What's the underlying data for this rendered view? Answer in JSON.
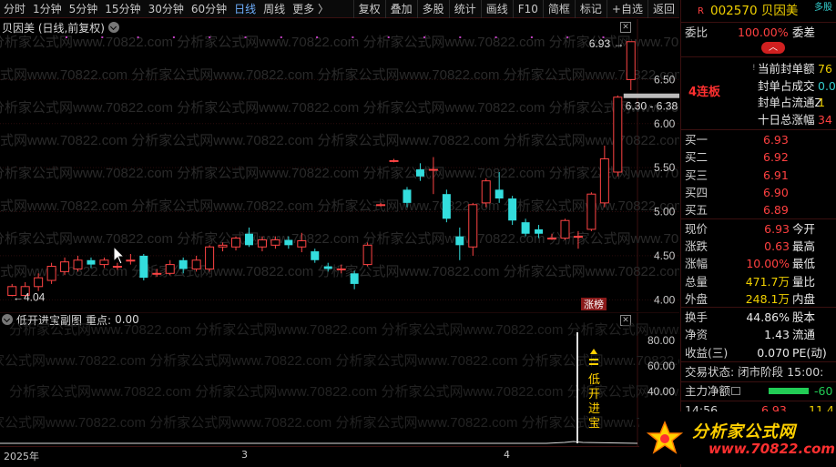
{
  "toolbar": {
    "periods": [
      "分时",
      "1分钟",
      "5分钟",
      "15分钟",
      "30分钟",
      "60分钟",
      "日线",
      "周线",
      "更多 〉"
    ],
    "buttons": [
      "复权",
      "叠加",
      "多股",
      "统计",
      "画线",
      "F10",
      "简框",
      "标记",
      "+自选",
      "返回"
    ]
  },
  "chart": {
    "title": "贝因美 (日线,前复权)",
    "y_ticks": [
      "6.50",
      "6.00",
      "5.50",
      "5.00",
      "4.50",
      "4.00"
    ],
    "high_label": "6.93",
    "low_label": "4.04",
    "price_box": "6.30 - 6.38",
    "zhangting_tag": "涨榜",
    "watermark": "分析家公式网www.70822.com"
  },
  "chart_data": {
    "type": "candlestick",
    "ylim": [
      3.9,
      7.0
    ],
    "candles": [
      {
        "o": 4.05,
        "c": 4.15,
        "h": 4.18,
        "l": 4.04
      },
      {
        "o": 4.05,
        "c": 4.15,
        "h": 4.2,
        "l": 4.03
      },
      {
        "o": 4.15,
        "c": 4.25,
        "h": 4.3,
        "l": 4.1
      },
      {
        "o": 4.22,
        "c": 4.38,
        "h": 4.42,
        "l": 4.18
      },
      {
        "o": 4.32,
        "c": 4.43,
        "h": 4.48,
        "l": 4.28
      },
      {
        "o": 4.35,
        "c": 4.45,
        "h": 4.5,
        "l": 4.32
      },
      {
        "o": 4.45,
        "c": 4.4,
        "h": 4.48,
        "l": 4.36
      },
      {
        "o": 4.4,
        "c": 4.45,
        "h": 4.48,
        "l": 4.36
      },
      {
        "o": 4.38,
        "c": 4.38,
        "h": 4.42,
        "l": 4.34
      },
      {
        "o": 4.45,
        "c": 4.45,
        "h": 4.52,
        "l": 4.4
      },
      {
        "o": 4.5,
        "c": 4.25,
        "h": 4.52,
        "l": 4.22
      },
      {
        "o": 4.3,
        "c": 4.3,
        "h": 4.35,
        "l": 4.26
      },
      {
        "o": 4.3,
        "c": 4.4,
        "h": 4.45,
        "l": 4.28
      },
      {
        "o": 4.45,
        "c": 4.35,
        "h": 4.48,
        "l": 4.3
      },
      {
        "o": 4.35,
        "c": 4.45,
        "h": 4.5,
        "l": 4.32
      },
      {
        "o": 4.35,
        "c": 4.6,
        "h": 4.62,
        "l": 4.32
      },
      {
        "o": 4.6,
        "c": 4.62,
        "h": 4.65,
        "l": 4.55
      },
      {
        "o": 4.6,
        "c": 4.7,
        "h": 4.72,
        "l": 4.56
      },
      {
        "o": 4.75,
        "c": 4.62,
        "h": 4.82,
        "l": 4.6
      },
      {
        "o": 4.6,
        "c": 4.68,
        "h": 4.72,
        "l": 4.55
      },
      {
        "o": 4.62,
        "c": 4.68,
        "h": 4.72,
        "l": 4.58
      },
      {
        "o": 4.68,
        "c": 4.62,
        "h": 4.72,
        "l": 4.58
      },
      {
        "o": 4.6,
        "c": 4.67,
        "h": 4.76,
        "l": 4.54
      },
      {
        "o": 4.55,
        "c": 4.45,
        "h": 4.58,
        "l": 4.42
      },
      {
        "o": 4.38,
        "c": 4.35,
        "h": 4.42,
        "l": 4.32
      },
      {
        "o": 4.35,
        "c": 4.35,
        "h": 4.4,
        "l": 4.3
      },
      {
        "o": 4.3,
        "c": 4.18,
        "h": 4.33,
        "l": 4.12
      },
      {
        "o": 4.4,
        "c": 4.62,
        "h": 4.65,
        "l": 4.38
      },
      {
        "o": 5.08,
        "c": 5.08,
        "h": 5.1,
        "l": 5.06
      },
      {
        "o": 5.58,
        "c": 5.58,
        "h": 5.6,
        "l": 5.56
      },
      {
        "o": 5.25,
        "c": 5.1,
        "h": 5.28,
        "l": 5.05
      },
      {
        "o": 5.48,
        "c": 5.4,
        "h": 5.55,
        "l": 5.35
      },
      {
        "o": 5.48,
        "c": 5.48,
        "h": 5.62,
        "l": 5.2
      },
      {
        "o": 5.2,
        "c": 4.92,
        "h": 5.25,
        "l": 4.88
      },
      {
        "o": 4.72,
        "c": 4.62,
        "h": 4.82,
        "l": 4.45
      },
      {
        "o": 4.6,
        "c": 5.08,
        "h": 5.1,
        "l": 4.5
      },
      {
        "o": 5.1,
        "c": 5.35,
        "h": 5.38,
        "l": 5.05
      },
      {
        "o": 5.25,
        "c": 5.15,
        "h": 5.45,
        "l": 5.1
      },
      {
        "o": 5.15,
        "c": 4.9,
        "h": 5.18,
        "l": 4.85
      },
      {
        "o": 4.88,
        "c": 4.75,
        "h": 4.92,
        "l": 4.72
      },
      {
        "o": 4.8,
        "c": 4.75,
        "h": 4.85,
        "l": 4.7
      },
      {
        "o": 4.7,
        "c": 4.7,
        "h": 4.75,
        "l": 4.68
      },
      {
        "o": 4.7,
        "c": 4.9,
        "h": 4.92,
        "l": 4.68
      },
      {
        "o": 4.72,
        "c": 4.72,
        "h": 4.78,
        "l": 4.58
      },
      {
        "o": 4.8,
        "c": 5.2,
        "h": 5.22,
        "l": 4.78
      },
      {
        "o": 5.1,
        "c": 5.6,
        "h": 5.75,
        "l": 5.05
      },
      {
        "o": 5.45,
        "c": 6.3,
        "h": 6.32,
        "l": 5.4
      },
      {
        "o": 6.5,
        "c": 6.93,
        "h": 6.93,
        "l": 6.38
      }
    ]
  },
  "subchart": {
    "title": "低开进宝副图",
    "key_label": "重点:",
    "key_value": "0.00",
    "y_ticks": [
      "80.00",
      "60.00",
      "40.00"
    ],
    "signal_chars": [
      "低",
      "开",
      "进",
      "宝"
    ]
  },
  "dates": [
    "2025年",
    "3",
    "4"
  ],
  "quote": {
    "code_name": "002570 贝因美",
    "r_mark": "R",
    "multi": "多股",
    "weibi_label": "委比",
    "weibi_value": "100.00%",
    "weicha_label": "委差",
    "lianban": "4连板",
    "info": [
      {
        "label": "当前封单额",
        "value": "76"
      },
      {
        "label": "封单占成交",
        "value": "0.0"
      },
      {
        "label": "封单占流通Z",
        "value": "1"
      },
      {
        "label": "十日总涨幅",
        "value": "34"
      }
    ],
    "bids": [
      {
        "label": "买一",
        "price": "6.93"
      },
      {
        "label": "买二",
        "price": "6.92"
      },
      {
        "label": "买三",
        "price": "6.91"
      },
      {
        "label": "买四",
        "price": "6.90"
      },
      {
        "label": "买五",
        "price": "6.89"
      }
    ],
    "stats": [
      {
        "l1": "现价",
        "v1": "6.93",
        "l2": "今开"
      },
      {
        "l1": "涨跌",
        "v1": "0.63",
        "l2": "最高"
      },
      {
        "l1": "涨幅",
        "v1": "10.00%",
        "l2": "最低"
      },
      {
        "l1": "总量",
        "v1": "471.7万",
        "l2": "量比"
      },
      {
        "l1": "外盘",
        "v1": "248.1万",
        "l2": "内盘"
      }
    ],
    "stats2": [
      {
        "l1": "换手",
        "v1": "44.86%",
        "l2": "股本"
      },
      {
        "l1": "净资",
        "v1": "1.43",
        "l2": "流通"
      },
      {
        "l1": "收益(三)",
        "v1": "0.070",
        "l2": "PE(动)"
      }
    ],
    "trade_status": "交易状态: 闭市阶段 15:00:",
    "main_flow_label": "主力净额",
    "main_flow_value": "-60",
    "tick_time": "14:56",
    "tick_price": "6.93",
    "tick_vol": "11.4"
  },
  "logo": {
    "text": "分析家公式网",
    "url": "www.70822.com"
  }
}
